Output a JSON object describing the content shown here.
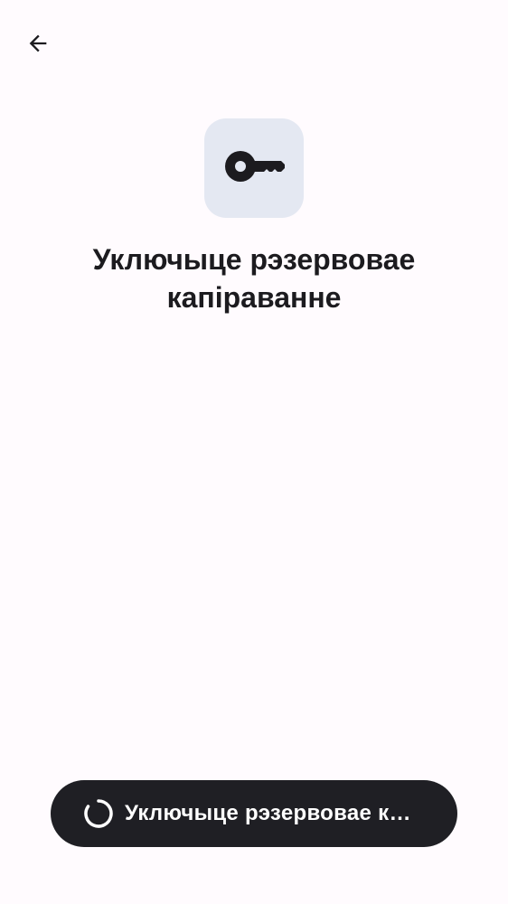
{
  "header": {
    "back_icon": "arrow-left-icon"
  },
  "hero": {
    "icon": "key-icon",
    "tile_color": "#e4e8f2"
  },
  "title": "Уключыце рэзервовае капіраванне",
  "primary_button": {
    "label": "Уключыце рэзервовае капіраванне",
    "state": "loading",
    "icon": "progress-spinner-icon",
    "background": "#1f1f24"
  }
}
